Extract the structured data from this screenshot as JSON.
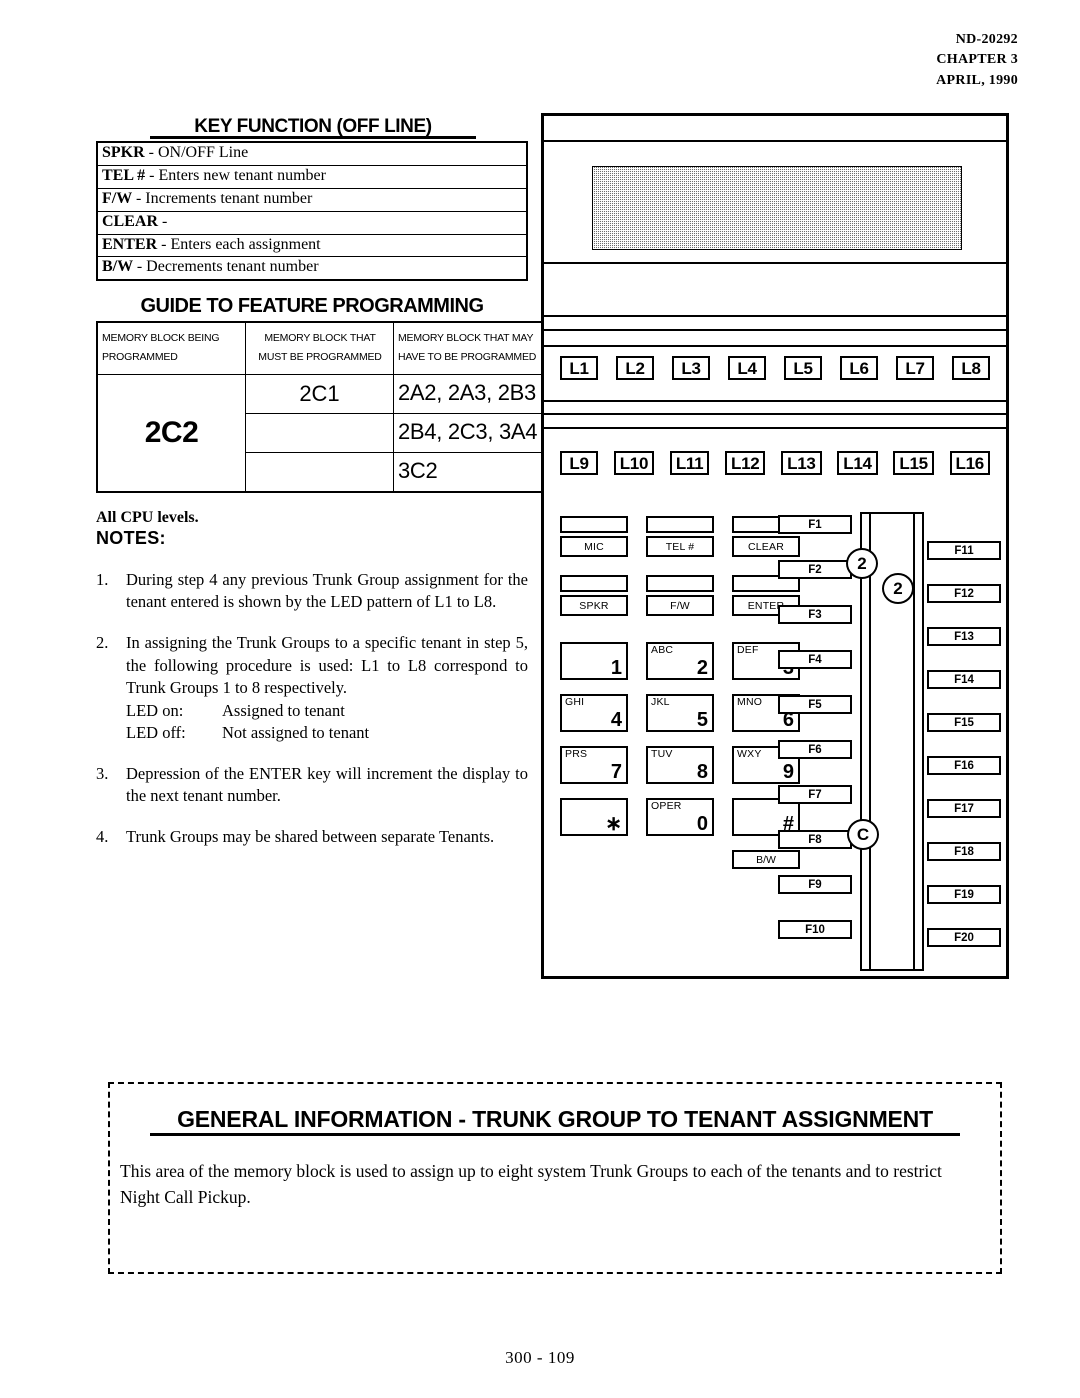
{
  "header": {
    "doc_number": "ND-20292",
    "chapter": "CHAPTER 3",
    "date": "APRIL, 1990"
  },
  "key_function": {
    "title": "KEY FUNCTION (OFF LINE)",
    "rows": [
      {
        "key": "SPKR",
        "desc": "- ON/OFF Line"
      },
      {
        "key": "TEL #",
        "desc": "-  Enters new tenant number"
      },
      {
        "key": "F/W",
        "desc": "-  Increments tenant number"
      },
      {
        "key": "CLEAR",
        "desc": "-"
      },
      {
        "key": "ENTER",
        "desc": "-   Enters each assignment"
      },
      {
        "key": "B/W",
        "desc": "- Decrements tenant number"
      }
    ]
  },
  "guide": {
    "title": "GUIDE TO FEATURE PROGRAMMING",
    "headers": {
      "being_programmed_l1": "MEMORY BLOCK BEING",
      "being_programmed_l2": "PROGRAMMED",
      "must_l1": "MEMORY BLOCK THAT",
      "must_l2": "MUST BE PROGRAMMED",
      "may_l1": "MEMORY BLOCK THAT MAY",
      "may_l2": "HAVE TO BE PROGRAMMED"
    },
    "block_being_programmed": "2C2",
    "must_be_programmed": [
      "2C1",
      "",
      ""
    ],
    "may_have_to_be_programmed": [
      "2A2, 2A3, 2B3",
      "2B4, 2C3, 3A4",
      "3C2"
    ]
  },
  "notes_section": {
    "cpu_levels": "All CPU levels.",
    "notes_label": "NOTES:",
    "notes": [
      {
        "num": "1.",
        "text": "During step 4 any previous Trunk Group assignment for the tenant entered is shown by the LED pattern of L1 to L8."
      },
      {
        "num": "2.",
        "text": "In assigning the Trunk Groups to a specific tenant in step 5, the following procedure is used: L1 to L8 correspond to Trunk Groups 1 to 8 respectively.",
        "led_on_label": "LED on:",
        "led_on_value": "Assigned to tenant",
        "led_off_label": "LED off:",
        "led_off_value": "Not assigned to tenant"
      },
      {
        "num": "3.",
        "text": "Depression of the ENTER key will increment the display to the next tenant number."
      },
      {
        "num": "4.",
        "text": "Trunk Groups may be shared between separate Tenants."
      }
    ]
  },
  "panel": {
    "line_keys_top": [
      "L1",
      "L2",
      "L3",
      "L4",
      "L5",
      "L6",
      "L7",
      "L8"
    ],
    "line_keys_bottom": [
      "L9",
      "L10",
      "L11",
      "L12",
      "L13",
      "L14",
      "L15",
      "L16"
    ],
    "function_keys": [
      {
        "label": "MIC"
      },
      {
        "label": "TEL #"
      },
      {
        "label": "CLEAR"
      },
      {
        "label": "SPKR"
      },
      {
        "label": "F/W"
      },
      {
        "label": "ENTER"
      }
    ],
    "keypad": [
      {
        "letters": "",
        "digit": "1"
      },
      {
        "letters": "ABC",
        "digit": "2"
      },
      {
        "letters": "DEF",
        "digit": "3"
      },
      {
        "letters": "GHI",
        "digit": "4"
      },
      {
        "letters": "JKL",
        "digit": "5"
      },
      {
        "letters": "MNO",
        "digit": "6"
      },
      {
        "letters": "PRS",
        "digit": "7"
      },
      {
        "letters": "TUV",
        "digit": "8"
      },
      {
        "letters": "WXY",
        "digit": "9"
      },
      {
        "letters": "",
        "digit": "∗"
      },
      {
        "letters": "OPER",
        "digit": "0"
      },
      {
        "letters": "",
        "digit": "#"
      }
    ],
    "bw_key": "B/W",
    "f_keys_left": [
      "F1",
      "F2",
      "F3",
      "F4",
      "F5",
      "F6",
      "F7",
      "F8",
      "F9",
      "F10"
    ],
    "f_keys_right": [
      "F11",
      "F12",
      "F13",
      "F14",
      "F15",
      "F16",
      "F17",
      "F18",
      "F19",
      "F20"
    ],
    "callouts": [
      "2",
      "2",
      "C"
    ]
  },
  "general_info": {
    "title": "GENERAL INFORMATION - TRUNK GROUP TO TENANT ASSIGNMENT",
    "body": "This area of the memory block is used to assign up to eight system Trunk Groups to each of the tenants and to restrict Night Call Pickup."
  },
  "footer": {
    "page": "300 - 109"
  }
}
